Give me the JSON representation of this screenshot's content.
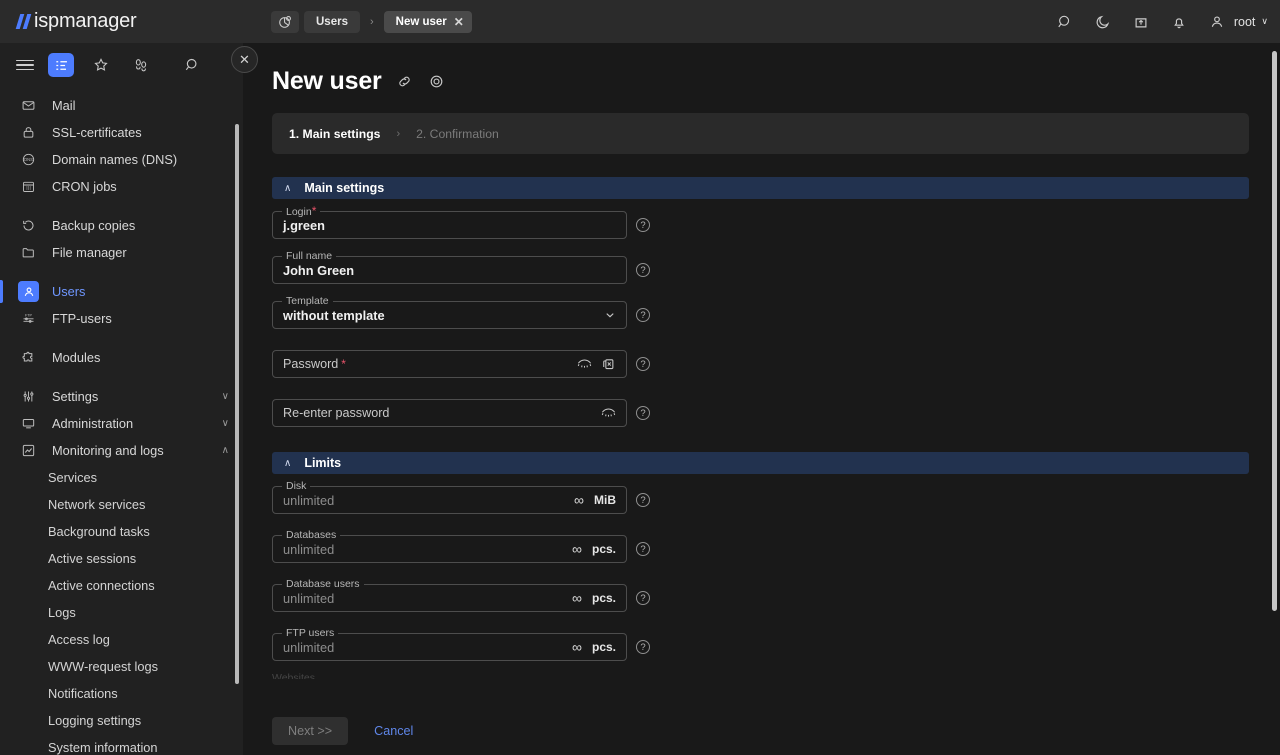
{
  "app": {
    "logo_text": "ispmanager"
  },
  "topbar": {
    "breadcrumb_icon": "pie-chart-icon",
    "crumbs": [
      {
        "label": "Users",
        "closable": false
      },
      {
        "label": "New user",
        "closable": true
      }
    ],
    "separator": "›",
    "close_glyph": "✕",
    "icons": [
      {
        "name": "search-icon"
      },
      {
        "name": "moon-icon"
      },
      {
        "name": "upload-box-icon"
      },
      {
        "name": "bell-icon"
      }
    ],
    "user": {
      "label": "root",
      "chevron": "∨"
    }
  },
  "sidebar": {
    "tools": [
      {
        "name": "menu-list-icon",
        "active": true
      },
      {
        "name": "star-icon",
        "active": false
      },
      {
        "name": "footsteps-icon",
        "active": false
      }
    ],
    "search_icon": "search-icon",
    "close_glyph": "✕",
    "items": [
      {
        "label": "Mail",
        "icon": "envelope-icon"
      },
      {
        "label": "SSL-certificates",
        "icon": "lock-icon"
      },
      {
        "label": "Domain names (DNS)",
        "icon": "dns-icon"
      },
      {
        "label": "CRON jobs",
        "icon": "calendar-icon"
      },
      {
        "label": "Backup copies",
        "icon": "restore-icon",
        "gap_before": true
      },
      {
        "label": "File manager",
        "icon": "folder-icon"
      },
      {
        "label": "Users",
        "icon": "user-icon",
        "active": true,
        "gap_before": true
      },
      {
        "label": "FTP-users",
        "icon": "ftp-icon"
      },
      {
        "label": "Modules",
        "icon": "puzzle-icon",
        "gap_before": true
      },
      {
        "label": "Settings",
        "icon": "sliders-icon",
        "chevron": "∨",
        "gap_before": true
      },
      {
        "label": "Administration",
        "icon": "monitor-icon",
        "chevron": "∨"
      },
      {
        "label": "Monitoring and logs",
        "icon": "chart-icon",
        "chevron": "∧"
      }
    ],
    "sub_items": [
      {
        "label": "Services"
      },
      {
        "label": "Network services"
      },
      {
        "label": "Background tasks"
      },
      {
        "label": "Active sessions"
      },
      {
        "label": "Active connections"
      },
      {
        "label": "Logs"
      },
      {
        "label": "Access log"
      },
      {
        "label": "WWW-request logs"
      },
      {
        "label": "Notifications"
      },
      {
        "label": "Logging settings"
      },
      {
        "label": "System information"
      }
    ]
  },
  "page": {
    "title": "New user",
    "head_icons": [
      {
        "name": "link-icon"
      },
      {
        "name": "target-icon"
      }
    ],
    "steps": [
      {
        "label": "1. Main settings",
        "state": "done"
      },
      {
        "label": "2. Confirmation",
        "state": "todo"
      }
    ],
    "step_separator": "›"
  },
  "sections": [
    {
      "title": "Main settings",
      "chevron": "∧",
      "fields": [
        {
          "label": "Login",
          "required": true,
          "value": "j.green",
          "label_mode": "float",
          "help": "?"
        },
        {
          "label": "Full name",
          "required": false,
          "value": "John Green",
          "label_mode": "float",
          "help": "?"
        },
        {
          "label": "Template",
          "required": false,
          "value": "without template",
          "label_mode": "float",
          "control": "select",
          "chevron": "∨",
          "help": "?"
        },
        {
          "label": "Password",
          "required": true,
          "value": "",
          "label_mode": "inner",
          "icons": [
            "eye-icon",
            "generate-password-icon"
          ],
          "help": "?",
          "spacer_before": true
        },
        {
          "label": "Re-enter password",
          "required": false,
          "value": "",
          "label_mode": "inner",
          "icons": [
            "eye-icon"
          ],
          "help": "?",
          "spacer_before": true
        }
      ]
    },
    {
      "title": "Limits",
      "chevron": "∧",
      "fields": [
        {
          "label": "Disk",
          "required": false,
          "value": "unlimited",
          "placeholder_style": true,
          "label_mode": "float",
          "infinity": "∞",
          "unit": "MiB",
          "help": "?"
        },
        {
          "label": "Databases",
          "required": false,
          "value": "unlimited",
          "placeholder_style": true,
          "label_mode": "float",
          "infinity": "∞",
          "unit": "pcs.",
          "help": "?",
          "spacer_before": true
        },
        {
          "label": "Database users",
          "required": false,
          "value": "unlimited",
          "placeholder_style": true,
          "label_mode": "float",
          "infinity": "∞",
          "unit": "pcs.",
          "help": "?",
          "spacer_before": true
        },
        {
          "label": "FTP users",
          "required": false,
          "value": "unlimited",
          "placeholder_style": true,
          "label_mode": "float",
          "infinity": "∞",
          "unit": "pcs.",
          "help": "?",
          "spacer_before": true
        }
      ],
      "clipped_next_label": "Websites"
    }
  ],
  "footer": {
    "next_label": "Next >>",
    "next_disabled": true,
    "cancel_label": "Cancel"
  },
  "colors": {
    "accent_blue": "#4d7cfe",
    "section_bar": "#22324f",
    "required_red": "#e8536a",
    "link_blue": "#5f86e8",
    "topbar_bg": "#2b2b2b",
    "sidebar_bg": "#212121",
    "main_bg": "#191919"
  }
}
